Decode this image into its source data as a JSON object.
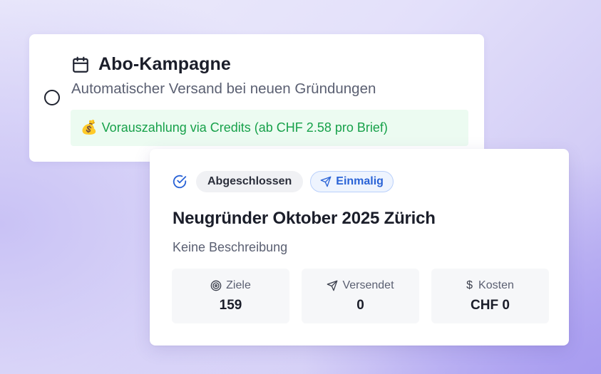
{
  "campaign_option": {
    "title": "Abo-Kampagne",
    "subtitle": "Automatischer Versand bei neuen Gründungen",
    "credit_emoji": "💰",
    "credit_note": "Vorauszahlung via Credits (ab CHF 2.58 pro Brief)",
    "title_icon": "calendar-icon",
    "selected": false
  },
  "campaign_card": {
    "status_icon": "check-circle-icon",
    "status_badge": "Abgeschlossen",
    "type_badge": "Einmalig",
    "type_icon": "send-icon",
    "title": "Neugründer Oktober 2025 Zürich",
    "description": "Keine Beschreibung",
    "stats": [
      {
        "icon": "target-icon",
        "label": "Ziele",
        "value": "159"
      },
      {
        "icon": "send-icon",
        "label": "Versendet",
        "value": "0"
      },
      {
        "icon": "dollar-icon",
        "label": "Kosten",
        "value": "CHF 0"
      }
    ]
  },
  "colors": {
    "credit_green": "#17a14a",
    "credit_bg": "#ecfbf1",
    "accent_blue": "#2a63d6",
    "badge_blue_bg": "#eef4fe",
    "text_dark": "#1b1e2a",
    "text_muted": "#5b6072"
  }
}
